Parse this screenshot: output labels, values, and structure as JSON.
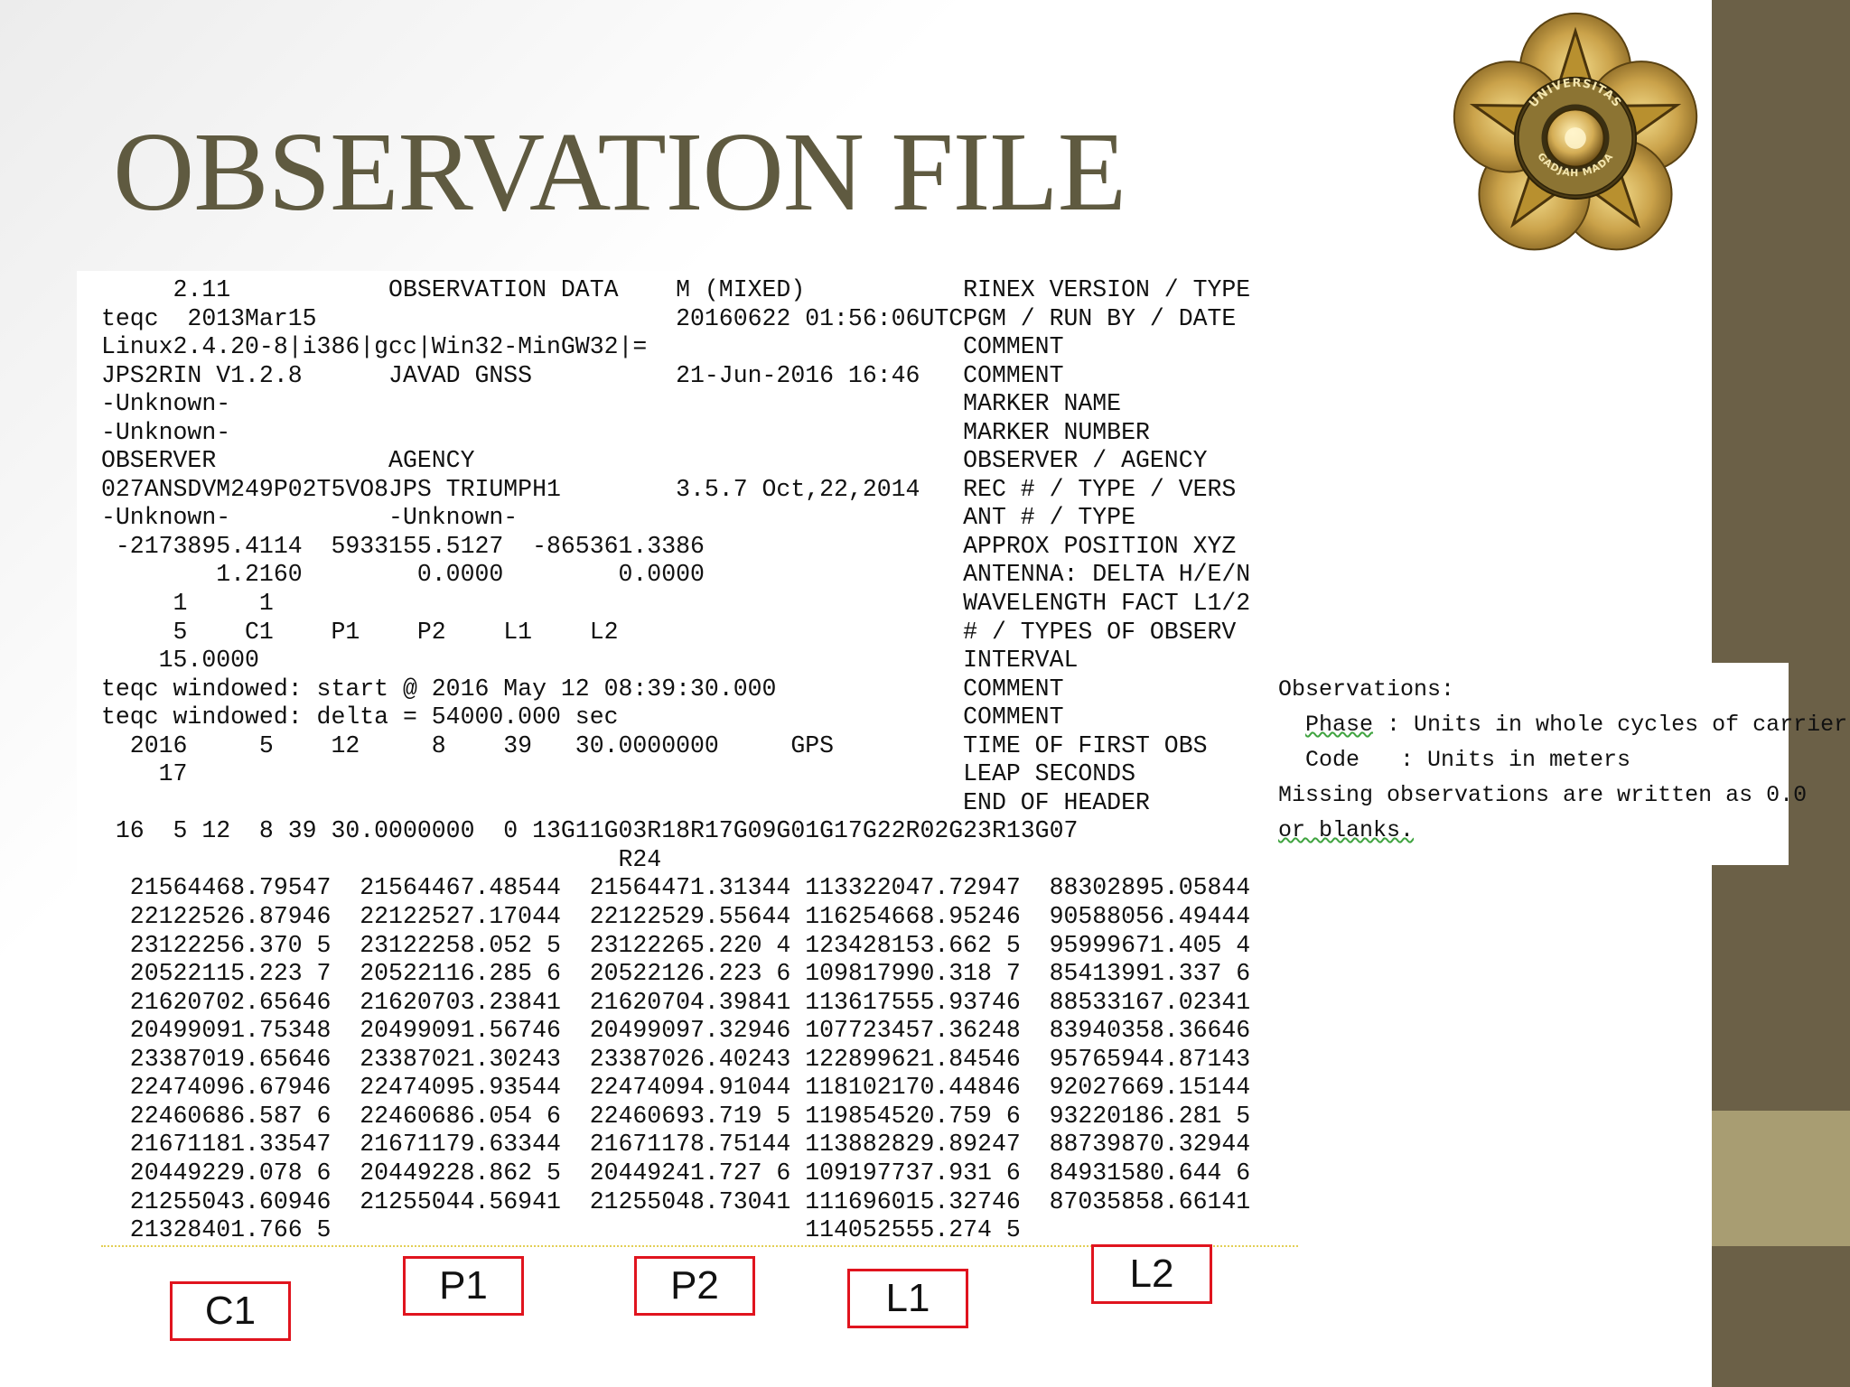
{
  "slide": {
    "title": "OBSERVATION FILE"
  },
  "rinex_lines": [
    "     2.11           OBSERVATION DATA    M (MIXED)           RINEX VERSION / TYPE",
    "teqc  2013Mar15                         20160622 01:56:06UTCPGM / RUN BY / DATE",
    "Linux2.4.20-8|i386|gcc|Win32-MinGW32|=                      COMMENT",
    "JPS2RIN V1.2.8      JAVAD GNSS          21-Jun-2016 16:46   COMMENT",
    "-Unknown-                                                   MARKER NAME",
    "-Unknown-                                                   MARKER NUMBER",
    "OBSERVER            AGENCY                                  OBSERVER / AGENCY",
    "027ANSDVM249P02T5VO8JPS TRIUMPH1        3.5.7 Oct,22,2014   REC # / TYPE / VERS",
    "-Unknown-           -Unknown-                               ANT # / TYPE",
    " -2173895.4114  5933155.5127  -865361.3386                  APPROX POSITION XYZ",
    "        1.2160        0.0000        0.0000                  ANTENNA: DELTA H/E/N",
    "     1     1                                                WAVELENGTH FACT L1/2",
    "     5    C1    P1    P2    L1    L2                        # / TYPES OF OBSERV",
    "    15.0000                                                 INTERVAL",
    "teqc windowed: start @ 2016 May 12 08:39:30.000             COMMENT",
    "teqc windowed: delta = 54000.000 sec                        COMMENT",
    "  2016     5    12     8    39   30.0000000     GPS         TIME OF FIRST OBS",
    "    17                                                      LEAP SECONDS",
    "                                                            END OF HEADER",
    " 16  5 12  8 39 30.0000000  0 13G11G03R18R17G09G01G17G22R02G23R13G07",
    "                                    R24",
    "  21564468.79547  21564467.48544  21564471.31344 113322047.72947  88302895.05844",
    "  22122526.87946  22122527.17044  22122529.55644 116254668.95246  90588056.49444",
    "  23122256.370 5  23122258.052 5  23122265.220 4 123428153.662 5  95999671.405 4",
    "  20522115.223 7  20522116.285 6  20522126.223 6 109817990.318 7  85413991.337 6",
    "  21620702.65646  21620703.23841  21620704.39841 113617555.93746  88533167.02341",
    "  20499091.75348  20499091.56746  20499097.32946 107723457.36248  83940358.36646",
    "  23387019.65646  23387021.30243  23387026.40243 122899621.84546  95765944.87143",
    "  22474096.67946  22474095.93544  22474094.91044 118102170.44846  92027669.15144",
    "  22460686.587 6  22460686.054 6  22460693.719 5 119854520.759 6  93220186.281 5",
    "  21671181.33547  21671179.63344  21671178.75144 113882829.89247  88739870.32944",
    "  20449229.078 6  20449228.862 5  20449241.727 6 109197737.931 6  84931580.644 6",
    "  21255043.60946  21255044.56941  21255048.73041 111696015.32746  87035858.66141",
    "  21328401.766 5                                 114052555.274 5"
  ],
  "column_labels": [
    "C1",
    "P1",
    "P2",
    "L1",
    "L2"
  ],
  "note": {
    "line1": "Observations:",
    "phase_word": "Phase",
    "phase_rest": " : Units in whole cycles of carrier",
    "code_line": "  Code   : Units in meters",
    "missing_line": "Missing observations are written as 0.0",
    "blanks_word": "or blanks."
  },
  "logo": {
    "icon": "university-emblem-icon",
    "top_text": "UNIVERSITAS",
    "bottom_text": "GADJAH MADA"
  },
  "colors": {
    "title": "#5f5a40",
    "side_bar": "#6b6047",
    "side_bar_accent": "#a89d72",
    "label_border": "#e0141e"
  }
}
